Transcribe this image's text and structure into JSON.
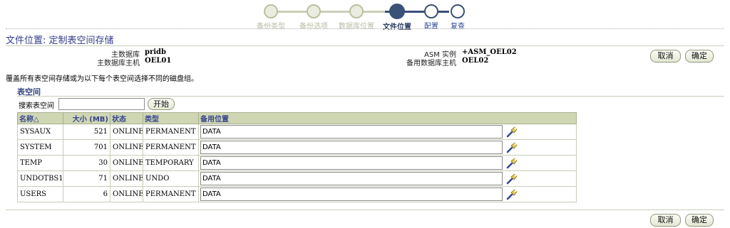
{
  "train": {
    "steps": [
      {
        "label": "备份类型",
        "state": "done"
      },
      {
        "label": "备份选项",
        "state": "done"
      },
      {
        "label": "数据库位置",
        "state": "done"
      },
      {
        "label": "文件位置",
        "state": "current"
      },
      {
        "label": "配置",
        "state": "todo"
      },
      {
        "label": "复查",
        "state": "todo"
      }
    ]
  },
  "page": {
    "title": "文件位置: 定制表空间存储",
    "description": "覆盖所有表空间存储或为以下每个表空间选择不同的磁盘组。"
  },
  "info": {
    "primary_db_label": "主数据库",
    "primary_db_value": "pridb",
    "primary_host_label": "主数据库主机",
    "primary_host_value": "OEL01",
    "asm_label": "ASM 实例",
    "asm_value": "+ASM_OEL02",
    "standby_host_label": "备用数据库主机",
    "standby_host_value": "OEL02"
  },
  "buttons": {
    "cancel": "取消",
    "ok": "确定",
    "go": "开始"
  },
  "section": {
    "title": "表空间",
    "search_label": "搜索表空间",
    "search_value": ""
  },
  "table": {
    "headers": {
      "name": "名称△",
      "size": "大小 (MB)",
      "status": "状态",
      "type": "类型",
      "location": "备用位置"
    },
    "rows": [
      {
        "name": "SYSAUX",
        "size": "521",
        "status": "ONLINE",
        "type": "PERMANENT",
        "location": "DATA"
      },
      {
        "name": "SYSTEM",
        "size": "701",
        "status": "ONLINE",
        "type": "PERMANENT",
        "location": "DATA"
      },
      {
        "name": "TEMP",
        "size": "30",
        "status": "ONLINE",
        "type": "TEMPORARY",
        "location": "DATA"
      },
      {
        "name": "UNDOTBS1",
        "size": "71",
        "status": "ONLINE",
        "type": "UNDO",
        "location": "DATA"
      },
      {
        "name": "USERS",
        "size": "6",
        "status": "ONLINE",
        "type": "PERMANENT",
        "location": "DATA"
      }
    ]
  }
}
